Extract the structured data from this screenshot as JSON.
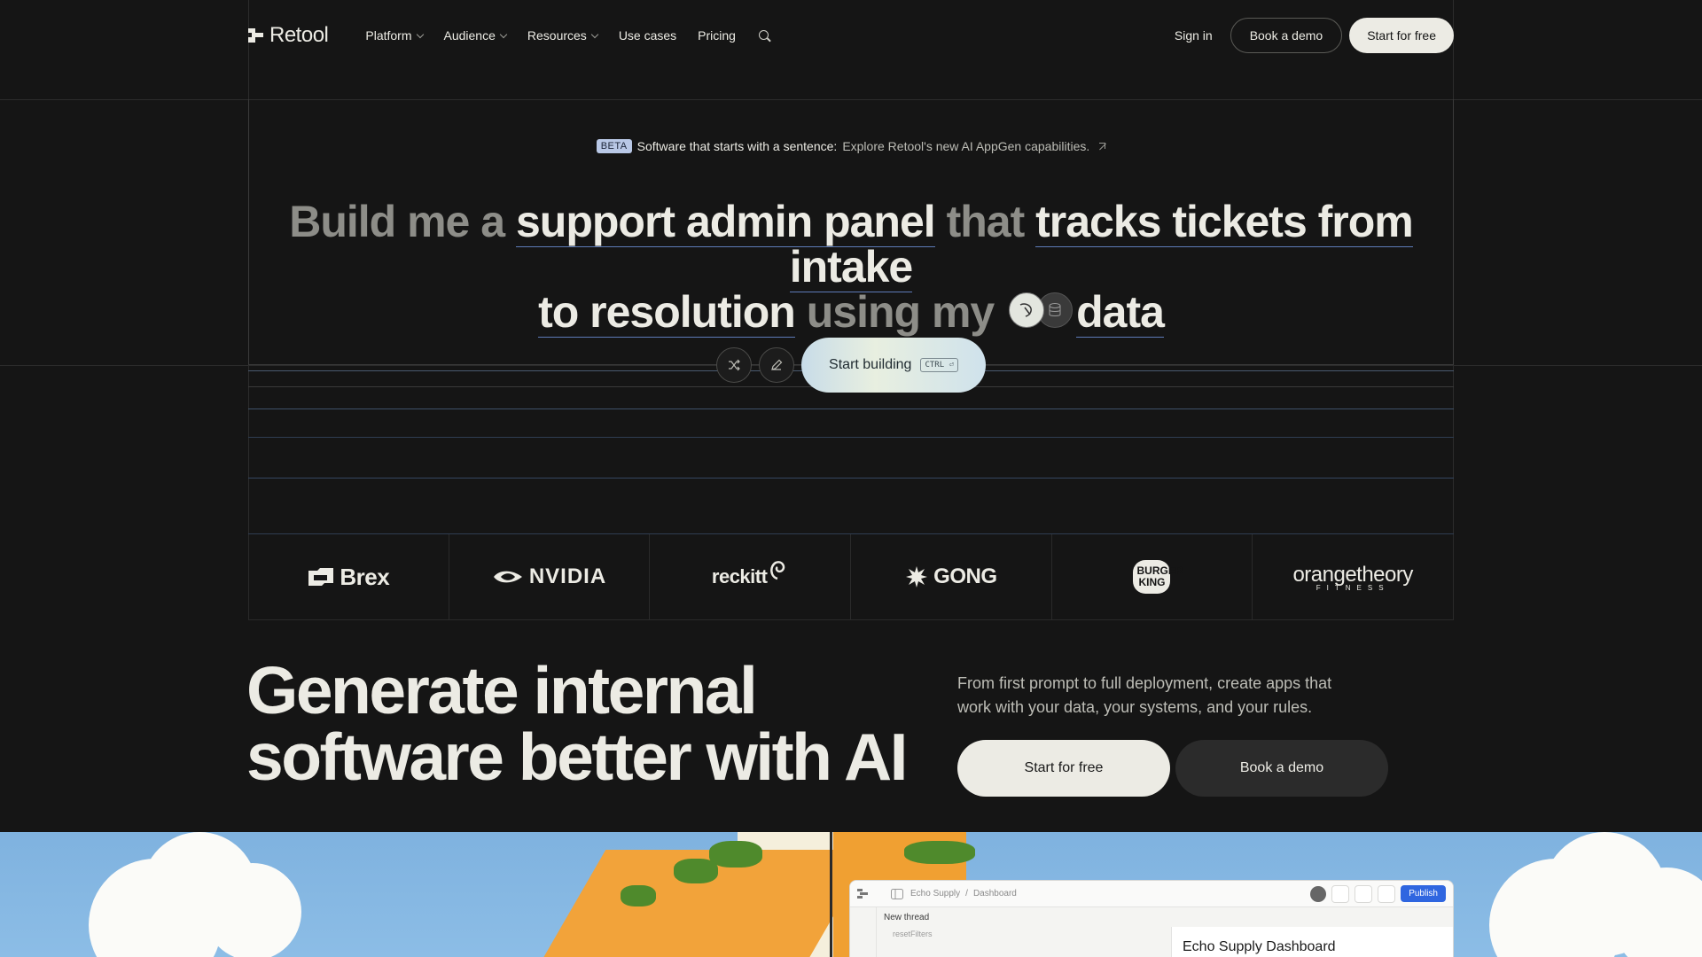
{
  "nav": {
    "logo": "Retool",
    "links": [
      {
        "label": "Platform",
        "dropdown": true
      },
      {
        "label": "Audience",
        "dropdown": true
      },
      {
        "label": "Resources",
        "dropdown": true
      },
      {
        "label": "Use cases",
        "dropdown": false
      },
      {
        "label": "Pricing",
        "dropdown": false
      }
    ],
    "sign_in": "Sign in",
    "book_demo": "Book a demo",
    "start_free": "Start for free"
  },
  "announcement": {
    "badge": "BETA",
    "strong": "Software that starts with a sentence:",
    "link": "Explore Retool's new AI AppGen capabilities."
  },
  "headline": {
    "p1": "Build me a ",
    "h1": "support admin panel",
    "p2": " that ",
    "h2": "tracks tickets from intake",
    "h3": "to resolution",
    "p3": " using my ",
    "h4": "data"
  },
  "builder": {
    "label": "Start building",
    "shortcut": "CTRL ⏎"
  },
  "logos": [
    "Brex",
    "NVIDIA",
    "reckitt",
    "GONG",
    "BURGER KING",
    "orangetheory"
  ],
  "logo_subtext": {
    "orangetheory": "FITNESS",
    "bk_line1": "BURGER",
    "bk_line2": "KING"
  },
  "hero2": {
    "title_line1": "Generate internal",
    "title_line2": "software better with AI",
    "subcopy": "From first prompt to full deployment, create apps that work with your data, your systems, and your rules.",
    "cta_primary": "Start for free",
    "cta_secondary": "Book a demo"
  },
  "app_preview": {
    "crumb_app": "Echo Supply",
    "crumb_sep": "/",
    "crumb_page": "Dashboard",
    "publish": "Publish",
    "thread_title": "New thread",
    "thread_item": "resetFilters",
    "dashboard_title": "Echo Supply Dashboard"
  },
  "colors": {
    "background": "#151515",
    "text": "#ecebe4",
    "muted": "#8d8d88",
    "accent_underline": "#5d7bb8",
    "publish": "#2f66e0"
  }
}
